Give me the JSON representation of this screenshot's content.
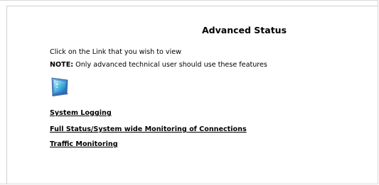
{
  "page": {
    "title": "Advanced Status",
    "instruction": "Click on the Link that you wish to view",
    "note_label": "NOTE:",
    "note_text": " Only advanced technical user should use these features",
    "icon": "monitor-icon"
  },
  "links": [
    {
      "label": "System Logging"
    },
    {
      "label": "Full Status/System wide Monitoring of Connections"
    },
    {
      "label": "Traffic Monitoring"
    }
  ]
}
